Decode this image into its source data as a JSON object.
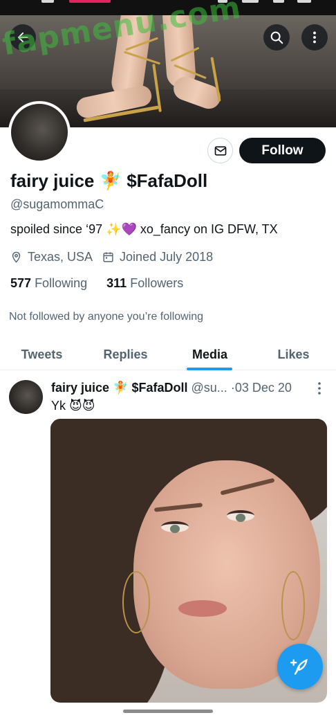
{
  "header": {
    "back_icon": "arrow-left-icon",
    "search_icon": "search-icon",
    "more_icon": "more-vertical-icon"
  },
  "watermark": {
    "text": "fapmenu.com"
  },
  "profile": {
    "name": "fairy juice 🧚 $FafaDoll",
    "handle": "@sugamommaC",
    "bio": "spoiled since ‘97 ✨💜 xo_fancy on IG   DFW, TX",
    "location": "Texas, USA",
    "joined": "Joined July 2018",
    "following_count": "577",
    "following_label": "Following",
    "followers_count": "311",
    "followers_label": "Followers",
    "not_followed": "Not followed by anyone you’re following"
  },
  "actions": {
    "message_icon": "envelope-icon",
    "follow_label": "Follow"
  },
  "tabs": [
    {
      "label": "Tweets"
    },
    {
      "label": "Replies"
    },
    {
      "label": "Media"
    },
    {
      "label": "Likes"
    }
  ],
  "active_tab": "Media",
  "tweet": {
    "author_name": "fairy juice 🧚 $FafaDoll",
    "author_handle": "@su...",
    "separator": "·",
    "date": "03 Dec 20",
    "text": "Yk 😈😈"
  },
  "compose_icon": "compose-feather-icon",
  "colors": {
    "accent": "#1d9bf0",
    "text_primary": "#0f1419",
    "text_secondary": "#536471",
    "follow_bg": "#0f1419",
    "watermark": "#3cbe3c"
  }
}
